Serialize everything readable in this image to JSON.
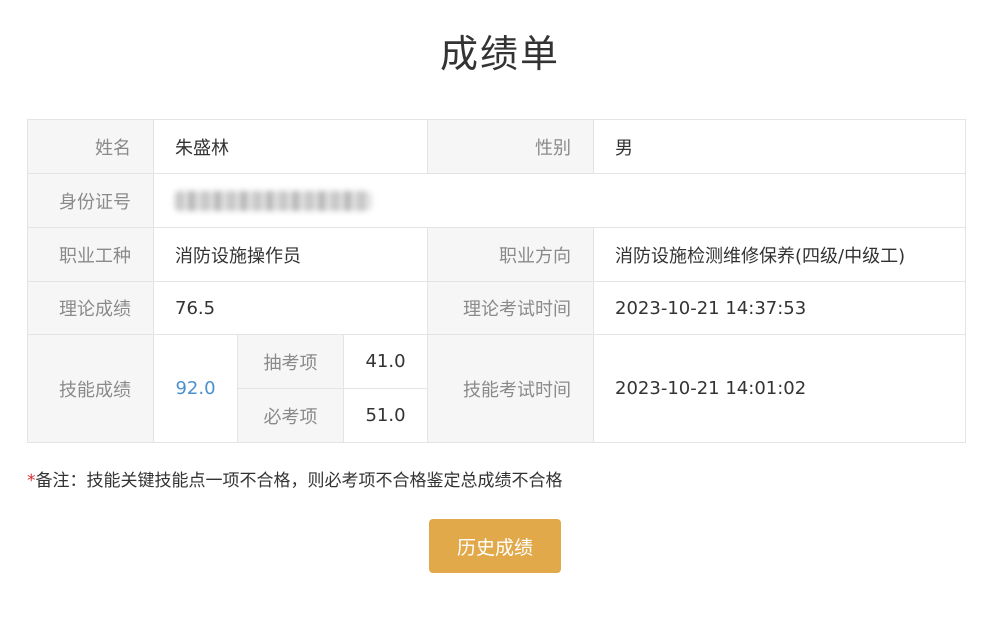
{
  "title": "成绩单",
  "table": {
    "name_label": "姓名",
    "name_value": "朱盛林",
    "gender_label": "性别",
    "gender_value": "男",
    "id_label": "身份证号",
    "job_type_label": "职业工种",
    "job_type_value": "消防设施操作员",
    "job_direction_label": "职业方向",
    "job_direction_value": "消防设施检测维修保养(四级/中级工)",
    "theory_score_label": "理论成绩",
    "theory_score_value": "76.5",
    "theory_time_label": "理论考试时间",
    "theory_time_value": "2023-10-21 14:37:53",
    "skill_score_label": "技能成绩",
    "skill_score_value": "92.0",
    "random_item_label": "抽考项",
    "random_item_value": "41.0",
    "required_item_label": "必考项",
    "required_item_value": "51.0",
    "skill_time_label": "技能考试时间",
    "skill_time_value": "2023-10-21 14:01:02"
  },
  "note": {
    "asterisk": "*",
    "text": "备注：技能关键技能点一项不合格，则必考项不合格鉴定总成绩不合格"
  },
  "history_button_label": "历史成绩",
  "colors": {
    "button": "#e2a94b",
    "skill_score": "#4a8fd0",
    "asterisk": "#e02f2f",
    "label_bg": "#f6f6f6",
    "border": "#e4e4e4"
  }
}
